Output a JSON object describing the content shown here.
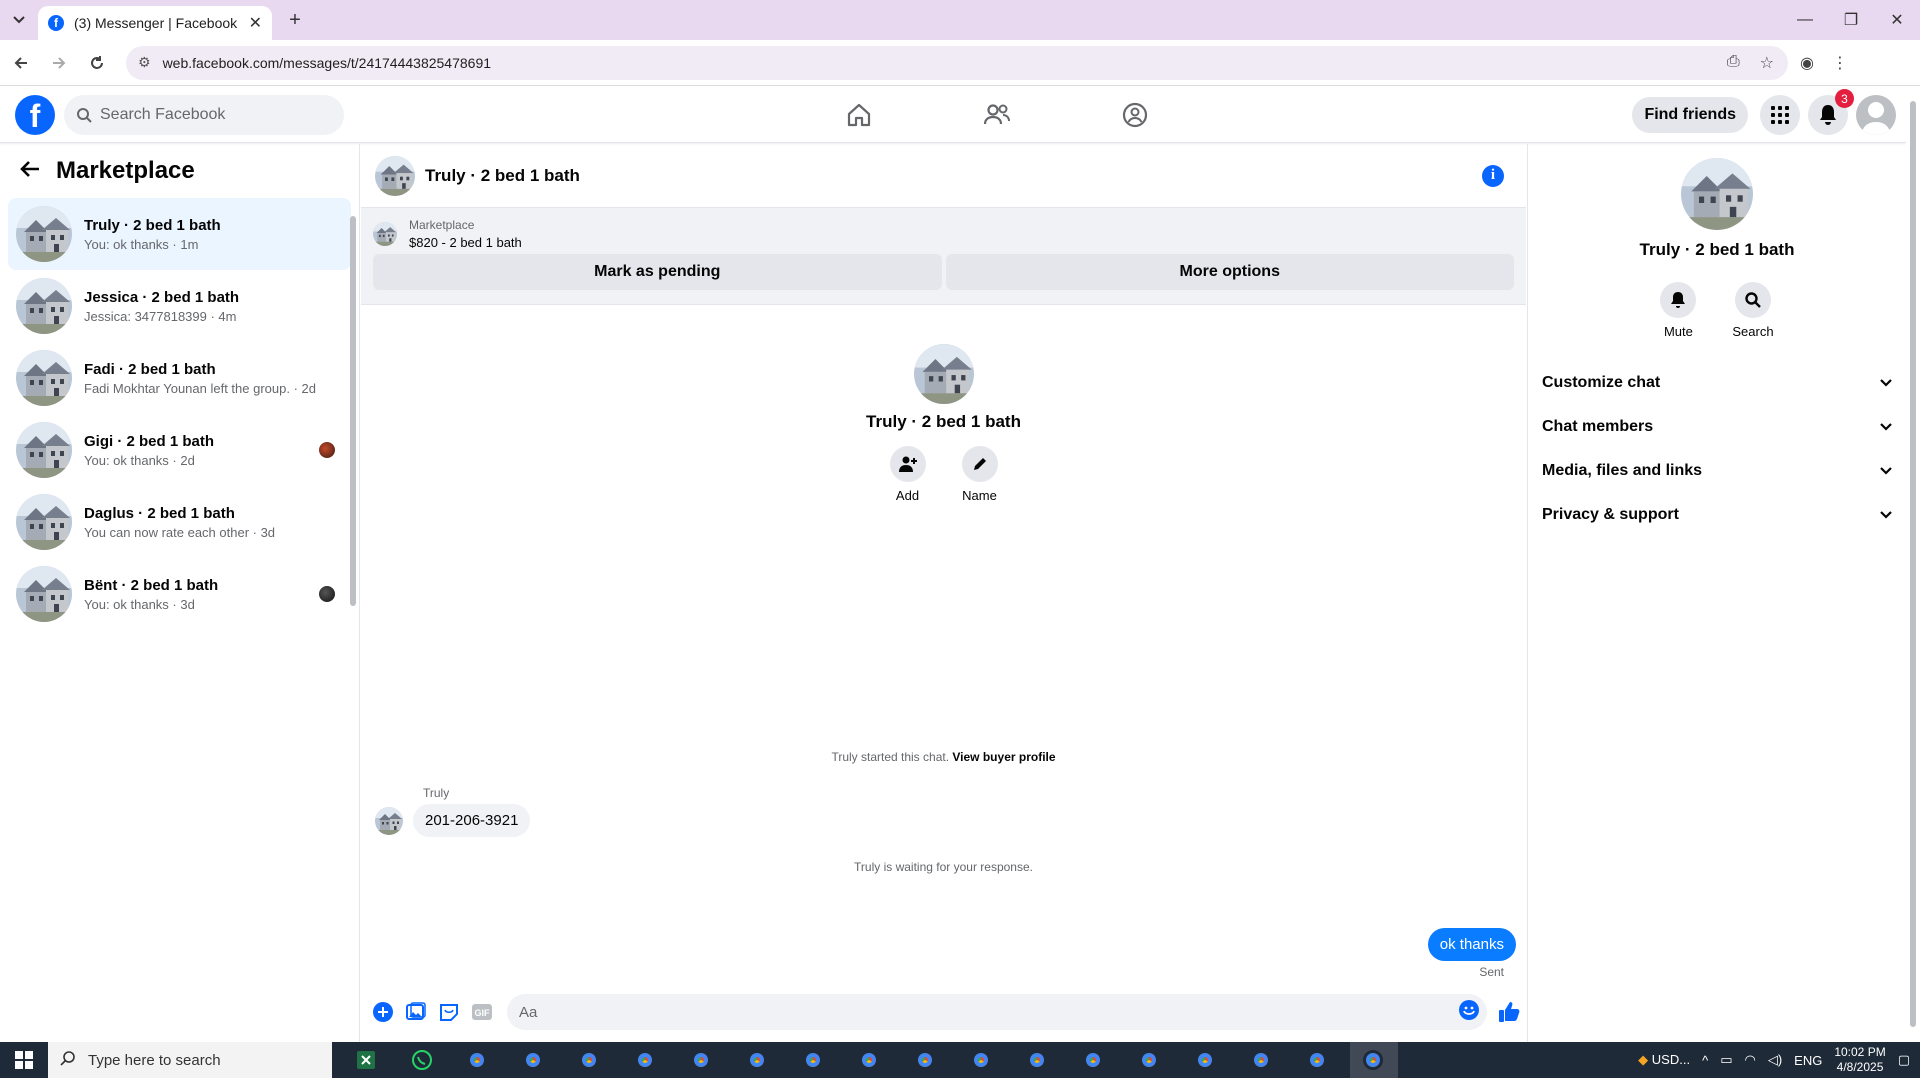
{
  "browser": {
    "tab_title": "(3) Messenger | Facebook",
    "url": "web.facebook.com/messages/t/24174443825478691",
    "new_tab_symbol": "+",
    "close_symbol": "✕"
  },
  "fb_header": {
    "logo_letter": "f",
    "search_placeholder": "Search Facebook",
    "find_friends_label": "Find friends",
    "notification_count": "3"
  },
  "left_panel": {
    "title": "Marketplace",
    "conversations": [
      {
        "name": "Truly · 2 bed 1 bath",
        "preview": "You: ok thanks · 1m"
      },
      {
        "name": "Jessica · 2 bed 1 bath",
        "preview": "Jessica: 3477818399 · 4m"
      },
      {
        "name": "Fadi · 2 bed 1 bath",
        "preview": "Fadi Mokhtar Younan left the group. · 2d"
      },
      {
        "name": "Gigi · 2 bed 1 bath",
        "preview": "You: ok thanks · 2d"
      },
      {
        "name": "Daglus · 2 bed 1 bath",
        "preview": "You can now rate each other · 3d"
      },
      {
        "name": "Bënt · 2 bed 1 bath",
        "preview": "You: ok thanks · 3d"
      }
    ]
  },
  "chat": {
    "title": "Truly · 2 bed 1 bath",
    "listing_source": "Marketplace",
    "listing_price": "$820 - 2 bed 1 bath",
    "mark_pending_label": "Mark as pending",
    "more_options_label": "More options",
    "intro_name": "Truly · 2 bed 1 bath",
    "add_label": "Add",
    "name_label": "Name",
    "started_text": "Truly started this chat.",
    "view_buyer_profile": "View buyer profile",
    "sender_label": "Truly",
    "incoming_message": "201-206-3921",
    "waiting_text": "Truly is waiting for your response.",
    "outgoing_message": "ok thanks",
    "sent_label": "Sent",
    "composer_placeholder": "Aa"
  },
  "right_panel": {
    "name": "Truly · 2 bed 1 bath",
    "mute_label": "Mute",
    "search_label": "Search",
    "sections": [
      "Customize chat",
      "Chat members",
      "Media, files and links",
      "Privacy & support"
    ]
  },
  "taskbar": {
    "search_placeholder": "Type here to search",
    "currency_label": "USD...",
    "language": "ENG",
    "time": "10:02 PM",
    "date": "4/8/2025"
  },
  "colors": {
    "fb_blue": "#0866ff",
    "messenger_blue": "#0a7cff",
    "active_conv": "#ebf5ff",
    "badge_red": "#e41e3f"
  }
}
